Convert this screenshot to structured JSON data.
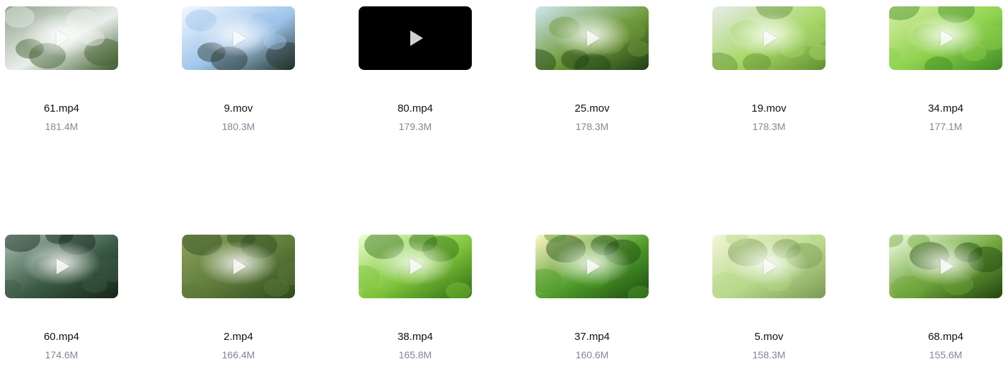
{
  "files": [
    {
      "name": "61.mp4",
      "size": "181.4M",
      "thumbnail": "pine-tree-canopy-bright-sky",
      "colors": [
        "#e9eeea",
        "#3b5a2a",
        "#8fa38a"
      ]
    },
    {
      "name": "9.mov",
      "size": "180.3M",
      "thumbnail": "blue-sky-sun-through-dark-trees",
      "colors": [
        "#9ec4ea",
        "#24322a",
        "#f4f8ff"
      ]
    },
    {
      "name": "80.mp4",
      "size": "179.3M",
      "thumbnail": "black-frame",
      "colors": [
        "#000000",
        "#000000",
        "#000000"
      ]
    },
    {
      "name": "25.mov",
      "size": "178.3M",
      "thumbnail": "fern-leaves-against-sky",
      "colors": [
        "#6f9a3a",
        "#1f3d15",
        "#cfe6f0"
      ]
    },
    {
      "name": "19.mov",
      "size": "178.3M",
      "thumbnail": "tall-tree-trunk-green-canopy",
      "colors": [
        "#a9d86a",
        "#5f8f2e",
        "#e8ecea"
      ]
    },
    {
      "name": "34.mp4",
      "size": "177.1M",
      "thumbnail": "bright-green-leaves-sunlight",
      "colors": [
        "#8ed14d",
        "#3f8a22",
        "#d8f0a8"
      ]
    },
    {
      "name": "60.mp4",
      "size": "174.6M",
      "thumbnail": "forest-canopy-looking-up",
      "colors": [
        "#3c5b44",
        "#15261a",
        "#a9c0b4"
      ]
    },
    {
      "name": "2.mp4",
      "size": "166.4M",
      "thumbnail": "butterfly-on-grass-blurred-green",
      "colors": [
        "#5e7a3a",
        "#2d4a1f",
        "#8fa35e"
      ]
    },
    {
      "name": "38.mp4",
      "size": "165.8M",
      "thumbnail": "sunburst-through-green-leaves",
      "colors": [
        "#7fc43a",
        "#2f6b12",
        "#eaffd0"
      ]
    },
    {
      "name": "37.mp4",
      "size": "160.6M",
      "thumbnail": "sun-behind-leafy-branches",
      "colors": [
        "#4f9c2a",
        "#1c4a10",
        "#fff6c8"
      ]
    },
    {
      "name": "5.mov",
      "size": "158.3M",
      "thumbnail": "birch-branches-soft-sun",
      "colors": [
        "#b8d98a",
        "#7a9a55",
        "#f3f6d8"
      ]
    },
    {
      "name": "68.mp4",
      "size": "155.6M",
      "thumbnail": "backlit-leaves-bright-sun",
      "colors": [
        "#6ea53a",
        "#22450f",
        "#f5ffe8"
      ]
    }
  ]
}
